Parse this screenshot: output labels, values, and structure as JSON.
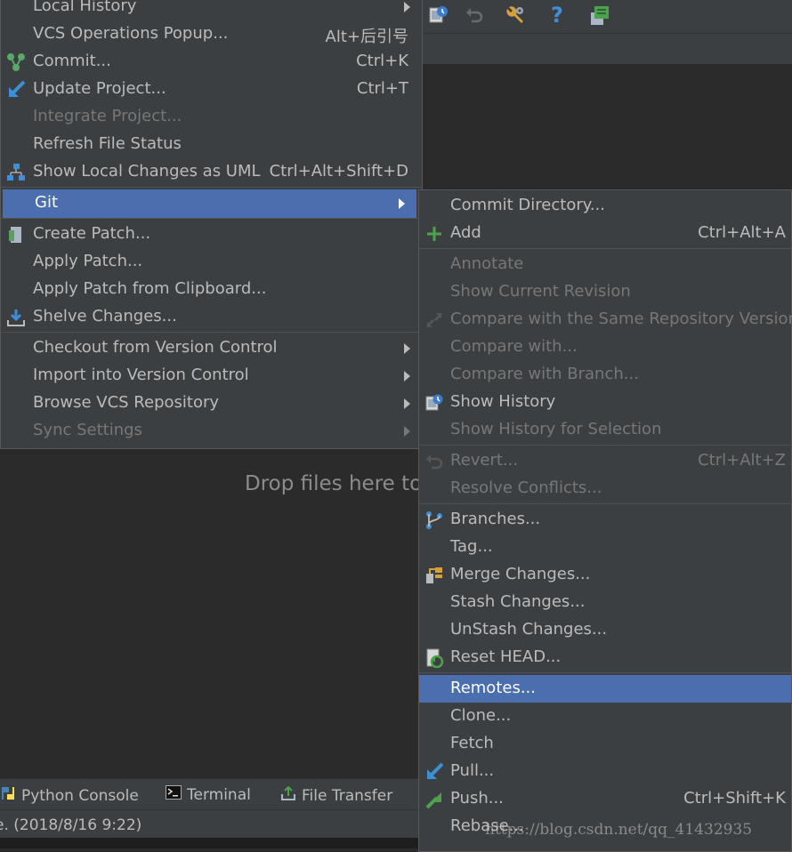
{
  "vcs_menu": {
    "items": [
      {
        "label": "Local History",
        "shortcut": "",
        "icon": "",
        "disabled": false,
        "submenu": true
      },
      {
        "label": "VCS Operations Popup...",
        "shortcut": "Alt+后引号",
        "icon": "",
        "disabled": false,
        "submenu": false
      },
      {
        "label": "Commit...",
        "shortcut": "Ctrl+K",
        "icon": "commit-icon",
        "disabled": false,
        "submenu": false
      },
      {
        "label": "Update Project...",
        "shortcut": "Ctrl+T",
        "icon": "update-project-icon",
        "disabled": false,
        "submenu": false
      },
      {
        "label": "Integrate Project...",
        "shortcut": "",
        "icon": "",
        "disabled": true,
        "submenu": false
      },
      {
        "label": "Refresh File Status",
        "shortcut": "",
        "icon": "",
        "disabled": false,
        "submenu": false
      },
      {
        "label": "Show Local Changes as UML",
        "shortcut": "Ctrl+Alt+Shift+D",
        "icon": "uml-diagram-icon",
        "disabled": false,
        "submenu": false
      },
      {
        "label": "Git",
        "shortcut": "",
        "icon": "",
        "disabled": false,
        "submenu": true,
        "selected": true
      },
      {
        "label": "Create Patch...",
        "shortcut": "",
        "icon": "create-patch-icon",
        "disabled": false,
        "submenu": false
      },
      {
        "label": "Apply Patch...",
        "shortcut": "",
        "icon": "",
        "disabled": false,
        "submenu": false
      },
      {
        "label": "Apply Patch from Clipboard...",
        "shortcut": "",
        "icon": "",
        "disabled": false,
        "submenu": false
      },
      {
        "label": "Shelve Changes...",
        "shortcut": "",
        "icon": "shelve-changes-icon",
        "disabled": false,
        "submenu": false
      },
      {
        "label": "Checkout from Version Control",
        "shortcut": "",
        "icon": "",
        "disabled": false,
        "submenu": true
      },
      {
        "label": "Import into Version Control",
        "shortcut": "",
        "icon": "",
        "disabled": false,
        "submenu": true
      },
      {
        "label": "Browse VCS Repository",
        "shortcut": "",
        "icon": "",
        "disabled": false,
        "submenu": true
      },
      {
        "label": "Sync Settings",
        "shortcut": "",
        "icon": "",
        "disabled": true,
        "submenu": true
      }
    ]
  },
  "git_submenu": {
    "items": [
      {
        "label": "Commit Directory...",
        "shortcut": "",
        "icon": "",
        "disabled": false
      },
      {
        "label": "Add",
        "shortcut": "Ctrl+Alt+A",
        "icon": "add-icon",
        "disabled": false
      },
      {
        "label": "Annotate",
        "shortcut": "",
        "icon": "",
        "disabled": true
      },
      {
        "label": "Show Current Revision",
        "shortcut": "",
        "icon": "",
        "disabled": true
      },
      {
        "label": "Compare with the Same Repository Version",
        "shortcut": "",
        "icon": "compare-icon",
        "disabled": true
      },
      {
        "label": "Compare with...",
        "shortcut": "",
        "icon": "",
        "disabled": true
      },
      {
        "label": "Compare with Branch...",
        "shortcut": "",
        "icon": "",
        "disabled": true
      },
      {
        "label": "Show History",
        "shortcut": "",
        "icon": "show-history-icon",
        "disabled": false
      },
      {
        "label": "Show History for Selection",
        "shortcut": "",
        "icon": "",
        "disabled": true
      },
      {
        "label": "Revert...",
        "shortcut": "Ctrl+Alt+Z",
        "icon": "revert-icon",
        "disabled": true
      },
      {
        "label": "Resolve Conflicts...",
        "shortcut": "",
        "icon": "",
        "disabled": true
      },
      {
        "label": "Branches...",
        "shortcut": "",
        "icon": "branches-icon",
        "disabled": false
      },
      {
        "label": "Tag...",
        "shortcut": "",
        "icon": "",
        "disabled": false
      },
      {
        "label": "Merge Changes...",
        "shortcut": "",
        "icon": "merge-icon",
        "disabled": false
      },
      {
        "label": "Stash Changes...",
        "shortcut": "",
        "icon": "",
        "disabled": false
      },
      {
        "label": "UnStash Changes...",
        "shortcut": "",
        "icon": "",
        "disabled": false
      },
      {
        "label": "Reset HEAD...",
        "shortcut": "",
        "icon": "reset-head-icon",
        "disabled": false
      },
      {
        "label": "Remotes...",
        "shortcut": "",
        "icon": "",
        "disabled": false,
        "selected": true
      },
      {
        "label": "Clone...",
        "shortcut": "",
        "icon": "",
        "disabled": false
      },
      {
        "label": "Fetch",
        "shortcut": "",
        "icon": "",
        "disabled": false
      },
      {
        "label": "Pull...",
        "shortcut": "",
        "icon": "pull-icon",
        "disabled": false
      },
      {
        "label": "Push...",
        "shortcut": "Ctrl+Shift+K",
        "icon": "push-icon",
        "disabled": false
      },
      {
        "label": "Rebase...",
        "shortcut": "",
        "icon": "",
        "disabled": false
      }
    ]
  },
  "editor": {
    "drop_hint": "Drop files here to"
  },
  "tool_window_tabs": [
    {
      "label": "Python Console",
      "icon": "python-console-icon"
    },
    {
      "label": "Terminal",
      "icon": "terminal-icon"
    },
    {
      "label": "File Transfer",
      "icon": "file-transfer-icon"
    }
  ],
  "status_bar": {
    "text": "e. (2018/8/16 9:22)"
  },
  "watermark": "https://blog.csdn.net/qq_41432935",
  "toolbar_icons": [
    "show-history-icon",
    "revert-icon",
    "settings-wrench-icon",
    "help-icon",
    "project-structure-icon"
  ],
  "colors": {
    "menu_bg": "#3c3f41",
    "selection": "#4b6eaf",
    "disabled_text": "#777777",
    "text": "#bbbbbb"
  }
}
